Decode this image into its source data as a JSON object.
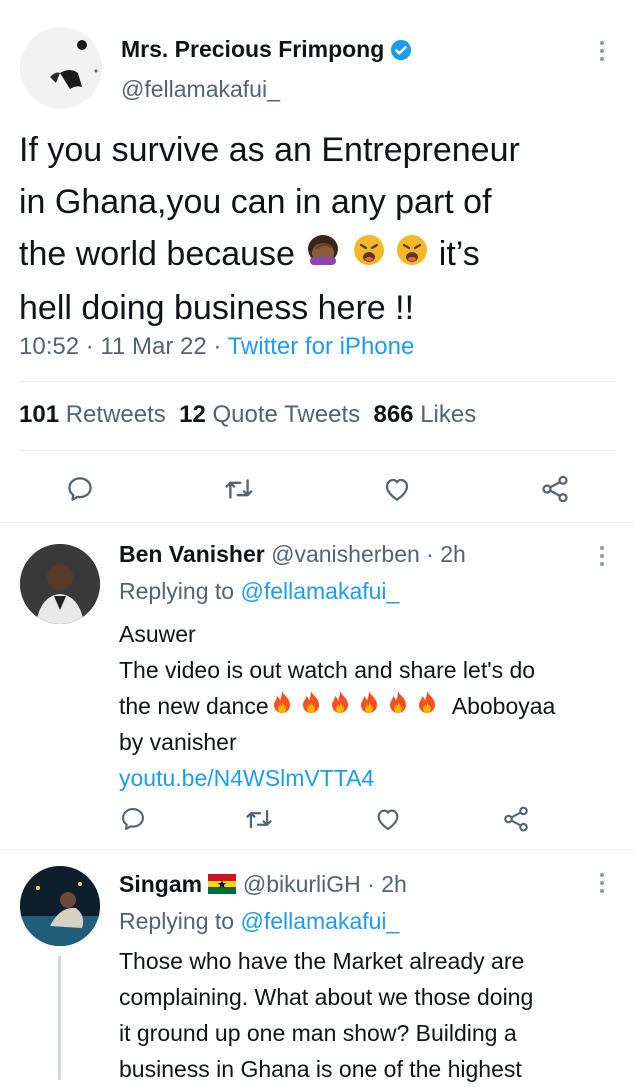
{
  "main_tweet": {
    "display_name": "Mrs. Precious Frimpong",
    "handle": "@fellamakafui_",
    "text_line1": "If you survive as an Entrepreneur",
    "text_line2": "in Ghana,you can in any part of",
    "text_line3_start": "the world because",
    "text_line3_end": "it’s",
    "text_line4": "hell doing business here !!",
    "time": "10:52",
    "date": "11 Mar 22",
    "source": "Twitter for iPhone",
    "retweets_count": "101",
    "retweets_label": "Retweets",
    "quotes_count": "12",
    "quotes_label": "Quote Tweets",
    "likes_count": "866",
    "likes_label": "Likes"
  },
  "replies": [
    {
      "display_name": "Ben Vanisher",
      "handle": "@vanisherben",
      "age": "2h",
      "replying_label": "Replying to",
      "replying_to": "@fellamakafui_",
      "text_line1": "Asuwer",
      "text_line2": "The video is out watch and share let's do",
      "text_line3_start": "the new dance",
      "text_line3_end": "Aboboyaa",
      "text_line4": "by vanisher",
      "link": "youtu.be/N4WSlmVTTA4"
    },
    {
      "display_name": "Singam",
      "handle": "@bikurliGH",
      "age": "2h",
      "replying_label": "Replying to",
      "replying_to": "@fellamakafui_",
      "text_line1": "Those who have the Market already are",
      "text_line2": "complaining. What about we those doing",
      "text_line3": "it ground up one man show? Building a",
      "text_line4": "business in Ghana is one of the highest"
    }
  ],
  "colors": {
    "accent": "#1d9bf0",
    "muted": "#536471"
  }
}
